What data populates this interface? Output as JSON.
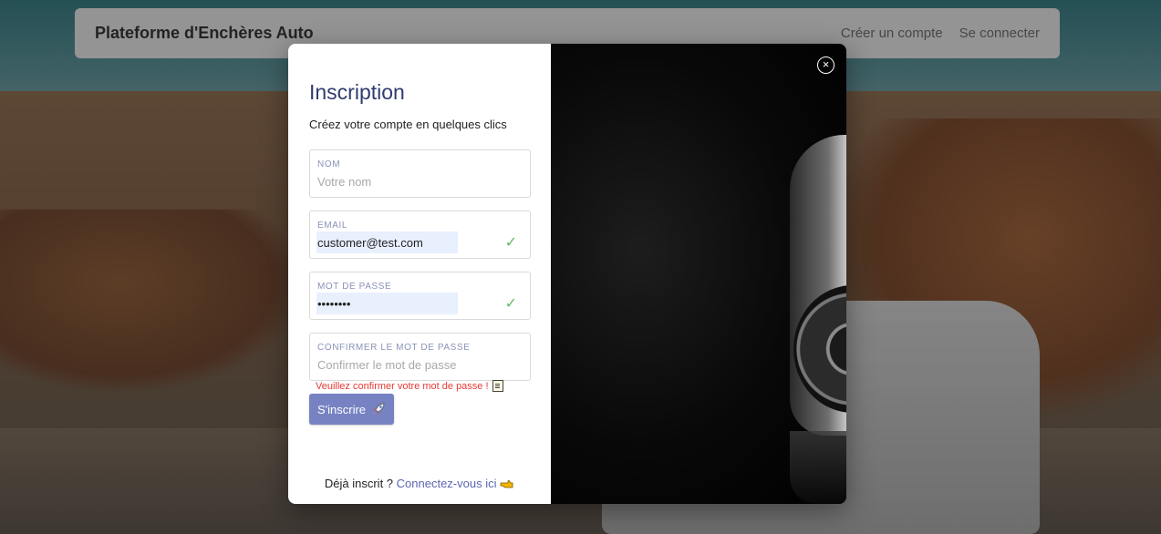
{
  "navbar": {
    "brand": "Plateforme d'Enchères Auto",
    "links": [
      "Créer un compte",
      "Se connecter"
    ]
  },
  "modal": {
    "title": "Inscription",
    "subtitle": "Créez votre compte en quelques clics",
    "fields": [
      {
        "label": "NOM",
        "value": "",
        "placeholder": "Votre nom",
        "valid": false
      },
      {
        "label": "EMAIL",
        "value": "customer@test.com",
        "placeholder": "",
        "valid": true
      },
      {
        "label": "MOT DE PASSE",
        "value": "••••••••",
        "placeholder": "",
        "valid": true
      },
      {
        "label": "CONFIRMER LE MOT DE PASSE",
        "value": "",
        "placeholder": "Confirmer le mot de passe",
        "valid": false
      }
    ],
    "error": "Veuillez confirmer votre mot de passe !",
    "submit_label": "S'inscrire",
    "footer_text": "Déjà inscrit ?",
    "footer_link": "Connectez-vous ici",
    "close_glyph": "×",
    "valid_glyph": "✓"
  },
  "colors": {
    "accent": "#7682c2",
    "title": "#2f3b6e",
    "error": "#e53935",
    "valid": "#62b86b"
  },
  "icons": [
    "check-icon",
    "rocket-icon",
    "note-icon",
    "pointing-hand-icon",
    "close-icon"
  ]
}
